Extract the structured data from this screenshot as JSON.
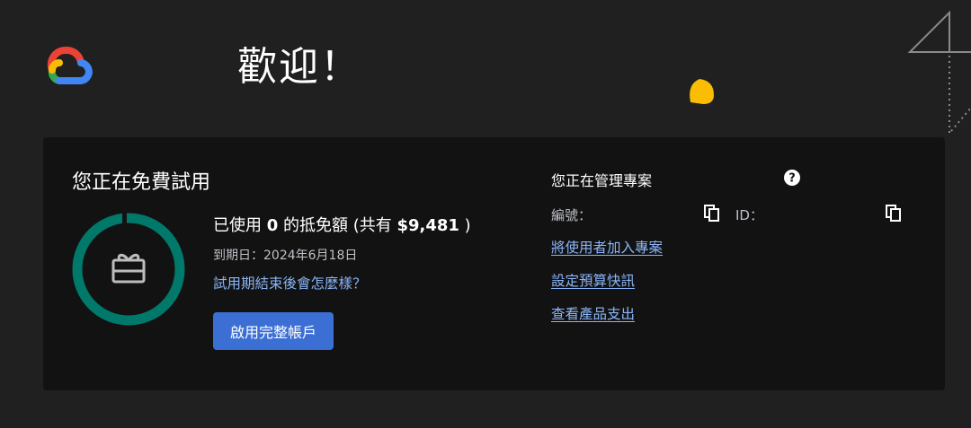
{
  "header": {
    "welcome": "歡迎！"
  },
  "trial": {
    "title": "您正在免費試用",
    "credits_prefix": "已使用 ",
    "credits_used": "0",
    "credits_middle": " 的抵免額 (共有 ",
    "credits_total": "$9,481",
    "credits_suffix": " )",
    "credits_used_fraction": 0,
    "expiry": "到期日：2024年6月18日",
    "trial_end_link": "試用期結束後會怎麼樣？",
    "upgrade_button": "啟用完整帳戶"
  },
  "project": {
    "title": "您正在管理專案",
    "number_label": "編號：",
    "id_label": "ID：",
    "links": [
      "將使用者加入專案",
      "設定預算快訊",
      "查看產品支出"
    ]
  },
  "icons": {
    "logo": "google-cloud-logo",
    "help": "help-circle-icon",
    "copy": "copy-icon",
    "gift": "gift-card-icon"
  },
  "colors": {
    "background": "#202020",
    "card": "#121212",
    "ring": "#00796b",
    "link": "#8ab4f8",
    "button": "#3b6fd4"
  }
}
